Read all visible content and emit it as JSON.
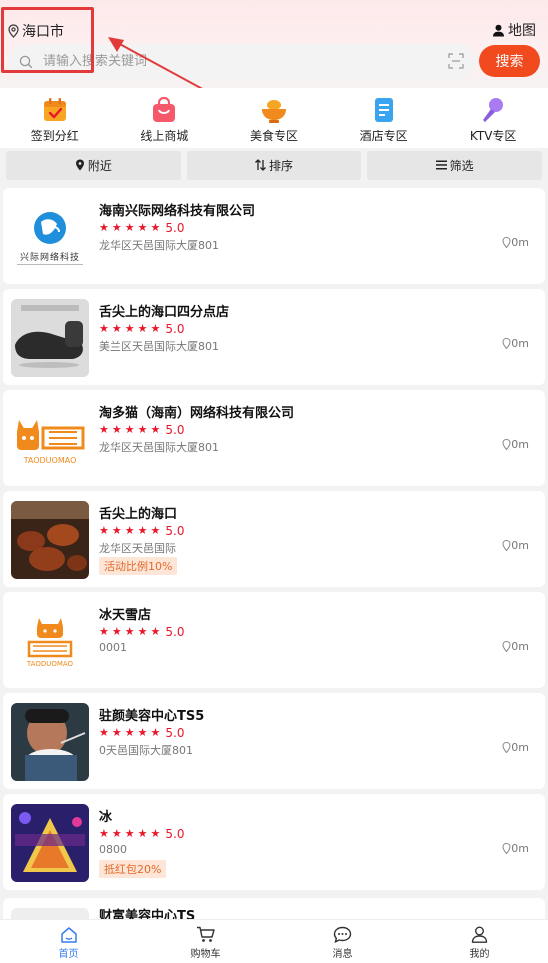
{
  "header": {
    "city": "海口市",
    "map_label": "地图",
    "search_placeholder": "请输入搜索关键词",
    "search_button": "搜索"
  },
  "categories": [
    {
      "label": "签到分红",
      "icon": "calendar-check-icon"
    },
    {
      "label": "线上商城",
      "icon": "shopping-bag-icon"
    },
    {
      "label": "美食专区",
      "icon": "food-bowl-icon"
    },
    {
      "label": "酒店专区",
      "icon": "hotel-building-icon"
    },
    {
      "label": "KTV专区",
      "icon": "microphone-icon"
    }
  ],
  "filters": [
    {
      "label": "附近",
      "icon": "location-pin-icon"
    },
    {
      "label": "排序",
      "icon": "sort-arrows-icon"
    },
    {
      "label": "筛选",
      "icon": "filter-lines-icon"
    }
  ],
  "shops": [
    {
      "name": "海南兴际网络科技有限公司",
      "rating": "5.0",
      "address": "龙华区天邑国际大厦801",
      "distance": "0m",
      "tag": "",
      "logo_text": "兴际网络科技"
    },
    {
      "name": "舌尖上的海口四分点店",
      "rating": "5.0",
      "address": "美兰区天邑国际大厦801",
      "distance": "0m",
      "tag": "",
      "logo_text": ""
    },
    {
      "name": "淘多猫（海南）网络科技有限公司",
      "rating": "5.0",
      "address": "龙华区天邑国际大厦801",
      "distance": "0m",
      "tag": "",
      "logo_text": "TAODUOMAO"
    },
    {
      "name": "舌尖上的海口",
      "rating": "5.0",
      "address": "龙华区天邑国际",
      "distance": "0m",
      "tag": "活动比例10%",
      "logo_text": ""
    },
    {
      "name": "冰天雪店",
      "rating": "5.0",
      "address": "0001",
      "distance": "0m",
      "tag": "",
      "logo_text": "TAODUOMAO"
    },
    {
      "name": "驻颜美容中心TS5",
      "rating": "5.0",
      "address": "0天邑国际大厦801",
      "distance": "0m",
      "tag": "",
      "logo_text": ""
    },
    {
      "name": "冰",
      "rating": "5.0",
      "address": "0800",
      "distance": "0m",
      "tag": "抵红包20%",
      "logo_text": ""
    },
    {
      "name": "财富美容中心TS",
      "rating": "",
      "address": "",
      "distance": "",
      "tag": "",
      "logo_text": ""
    }
  ],
  "tabbar": [
    {
      "label": "首页",
      "icon": "home-icon",
      "active": true
    },
    {
      "label": "购物车",
      "icon": "cart-icon",
      "active": false
    },
    {
      "label": "消息",
      "icon": "message-icon",
      "active": false
    },
    {
      "label": "我的",
      "icon": "user-icon",
      "active": false
    }
  ],
  "colors": {
    "accent": "#f04a1e",
    "star": "#e8182b",
    "active_tab": "#3a7cf0",
    "annotation": "#e23a3a"
  }
}
